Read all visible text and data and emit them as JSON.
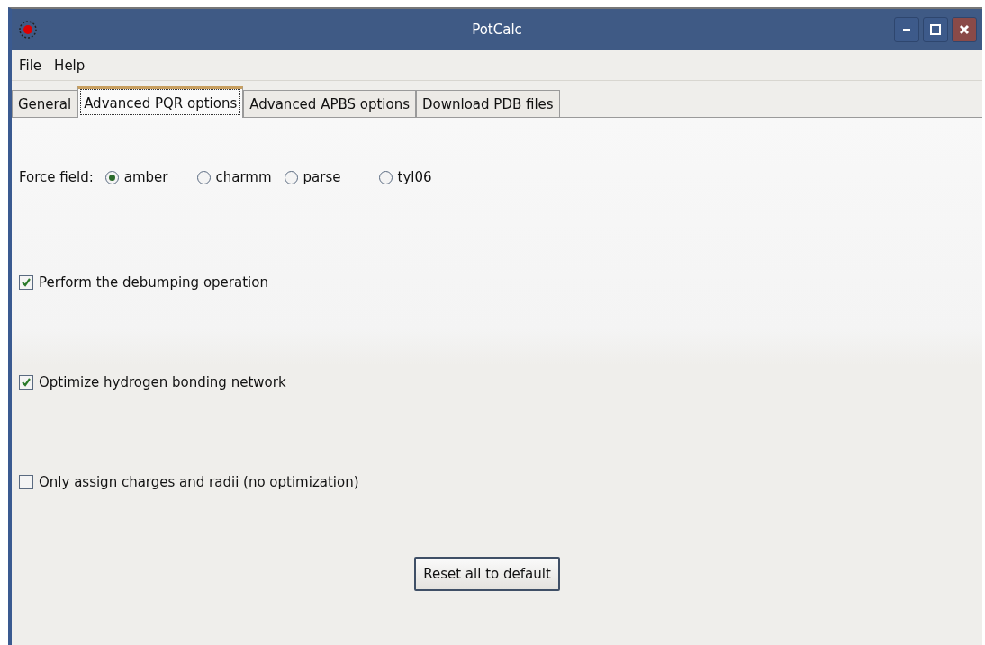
{
  "window": {
    "title": "PotCalc"
  },
  "menu": [
    "File",
    "Help"
  ],
  "tabs": [
    {
      "label": "General",
      "selected": false
    },
    {
      "label": "Advanced PQR options",
      "selected": true
    },
    {
      "label": "Advanced APBS options",
      "selected": false
    },
    {
      "label": "Download PDB files",
      "selected": false
    }
  ],
  "force_field": {
    "label": "Force field:",
    "options": [
      {
        "label": "amber",
        "selected": true
      },
      {
        "label": "charmm",
        "selected": false
      },
      {
        "label": "parse",
        "selected": false
      },
      {
        "label": "tyl06",
        "selected": false
      }
    ]
  },
  "options": [
    {
      "label": "Perform the debumping operation",
      "checked": true
    },
    {
      "label": "Optimize hydrogen bonding network",
      "checked": true
    },
    {
      "label": "Only assign charges and radii (no optimization)",
      "checked": false
    }
  ],
  "buttons": [
    "Reset all to default"
  ]
}
